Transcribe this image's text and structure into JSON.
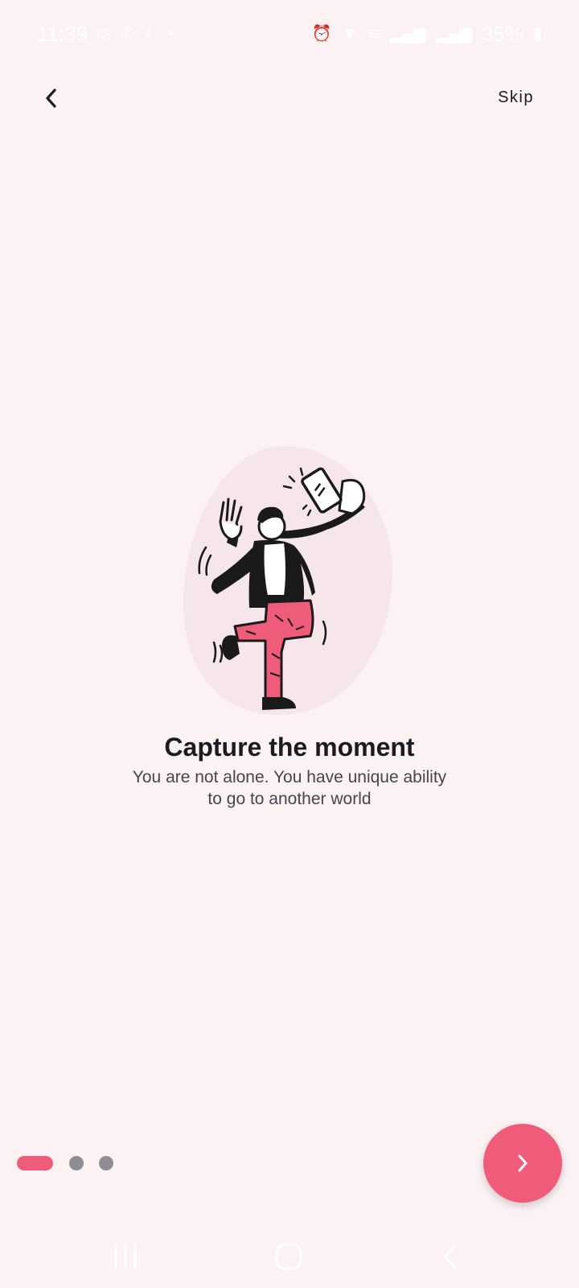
{
  "status_bar": {
    "time": "11:39",
    "battery": "35%",
    "icons": [
      "whatsapp-icon",
      "call-icon",
      "night-mode-icon",
      "dot-icon",
      "alarm-icon",
      "download-icon",
      "wifi-icon",
      "signal-icon",
      "signal-icon",
      "battery-icon"
    ]
  },
  "top_bar": {
    "back_icon": "chevron-left-icon",
    "skip_label": "Skip"
  },
  "onboarding": {
    "title": "Capture the moment",
    "subtitle": "You are not alone. You have unique ability to go to another world",
    "page_index": 1,
    "page_count": 3
  },
  "next_button": {
    "icon": "chevron-right-icon"
  },
  "colors": {
    "background": "#fdf2f3",
    "accent": "#ef5b78",
    "blob": "#f6e6ea",
    "inactive_dot": "#8e8d93"
  },
  "nav_bar": {
    "icons": [
      "recent-apps-icon",
      "home-icon",
      "back-icon"
    ]
  }
}
